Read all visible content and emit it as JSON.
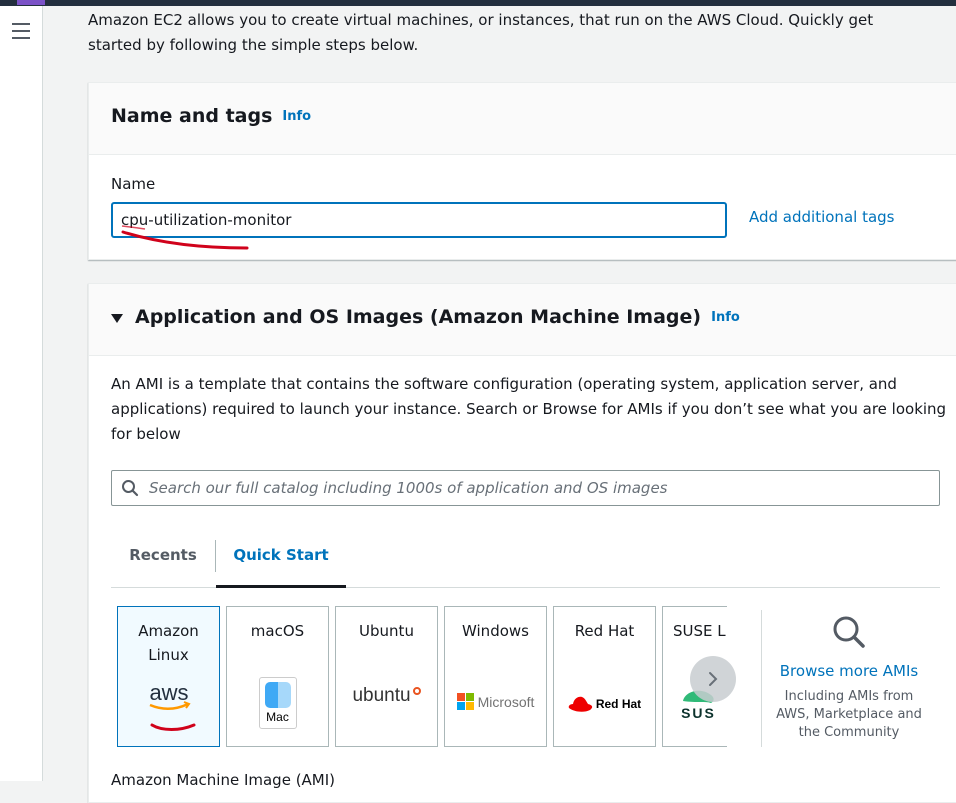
{
  "intro": {
    "text": "Amazon EC2 allows you to create virtual machines, or instances, that run on the AWS Cloud. Quickly get started by following the simple steps below."
  },
  "name_and_tags": {
    "title": "Name and tags",
    "info": "Info",
    "name_label": "Name",
    "name_value": "cpu-utilization-monitor",
    "add_tags": "Add additional tags"
  },
  "ami": {
    "title": "Application and OS Images (Amazon Machine Image)",
    "info": "Info",
    "description": "An AMI is a template that contains the software configuration (operating system, application server, and applications) required to launch your instance. Search or Browse for AMIs if you don’t see what you are looking for below",
    "search_placeholder": "Search our full catalog including 1000s of application and OS images",
    "tabs": [
      {
        "label": "Recents",
        "active": false
      },
      {
        "label": "Quick Start",
        "active": true
      }
    ],
    "os_tiles": [
      {
        "name": "Amazon Linux",
        "logo_text": "aws",
        "selected": true
      },
      {
        "name": "macOS",
        "logo_text": "Mac",
        "selected": false
      },
      {
        "name": "Ubuntu",
        "logo_text": "ubuntu",
        "selected": false
      },
      {
        "name": "Windows",
        "logo_text": "Microsoft",
        "selected": false
      },
      {
        "name": "Red Hat",
        "logo_text": "Red Hat",
        "selected": false
      },
      {
        "name": "SUSE Linux",
        "logo_text": "SUS",
        "selected": false
      }
    ],
    "browse": {
      "link": "Browse more AMIs",
      "note": "Including AMIs from AWS, Marketplace and the Community"
    },
    "footer_label": "Amazon Machine Image (AMI)"
  },
  "colors": {
    "link": "#0073bb",
    "selected_tile_bg": "#f1faff",
    "annotation_red": "#d0021b",
    "topbar": "#232f3e"
  }
}
